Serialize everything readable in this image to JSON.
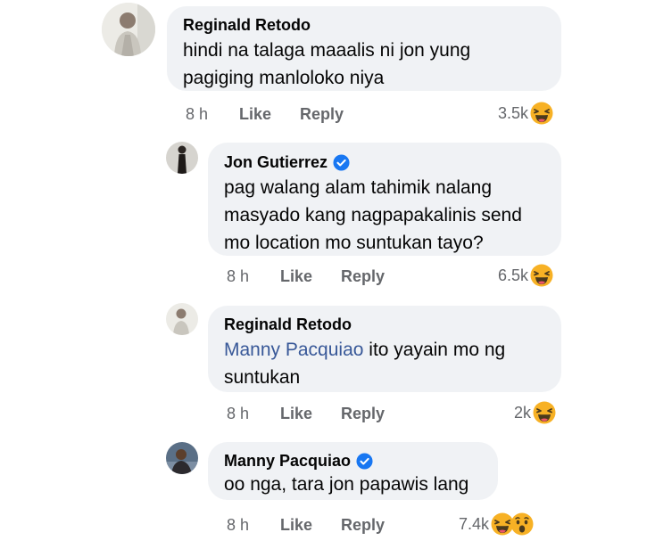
{
  "comments": [
    {
      "author": "Reginald Retodo",
      "lines": [
        "hindi na talaga maaalis ni jon yung",
        "pagiging manloloko niya"
      ],
      "time": "8 h",
      "like": "Like",
      "reply": "Reply",
      "reactions": "3.5k",
      "reaction_icons": [
        "haha-icon"
      ]
    },
    {
      "author": "Jon Gutierrez",
      "verified": true,
      "lines": [
        "pag walang alam tahimik nalang",
        "masyado kang nagpapakalinis send",
        "mo location mo suntukan tayo?"
      ],
      "time": "8 h",
      "like": "Like",
      "reply": "Reply",
      "reactions": "6.5k",
      "reaction_icons": [
        "haha-icon"
      ]
    },
    {
      "author": "Reginald Retodo",
      "mention": "Manny Pacquiao",
      "line1_rest": " ito yayain mo ng",
      "line2": "suntukan",
      "time": "8 h",
      "like": "Like",
      "reply": "Reply",
      "reactions": "2k",
      "reaction_icons": [
        "haha-icon"
      ]
    },
    {
      "author": "Manny Pacquiao",
      "verified": true,
      "lines": [
        "oo nga, tara jon papawis lang"
      ],
      "time": "8 h",
      "like": "Like",
      "reply": "Reply",
      "reactions": "7.4k",
      "reaction_icons": [
        "haha-icon",
        "wow-icon"
      ]
    }
  ],
  "colors": {
    "bubble": "#f0f2f5",
    "mention": "#385898",
    "meta": "#65676b",
    "verified": "#1877f2",
    "emoji": "#f7b125"
  }
}
